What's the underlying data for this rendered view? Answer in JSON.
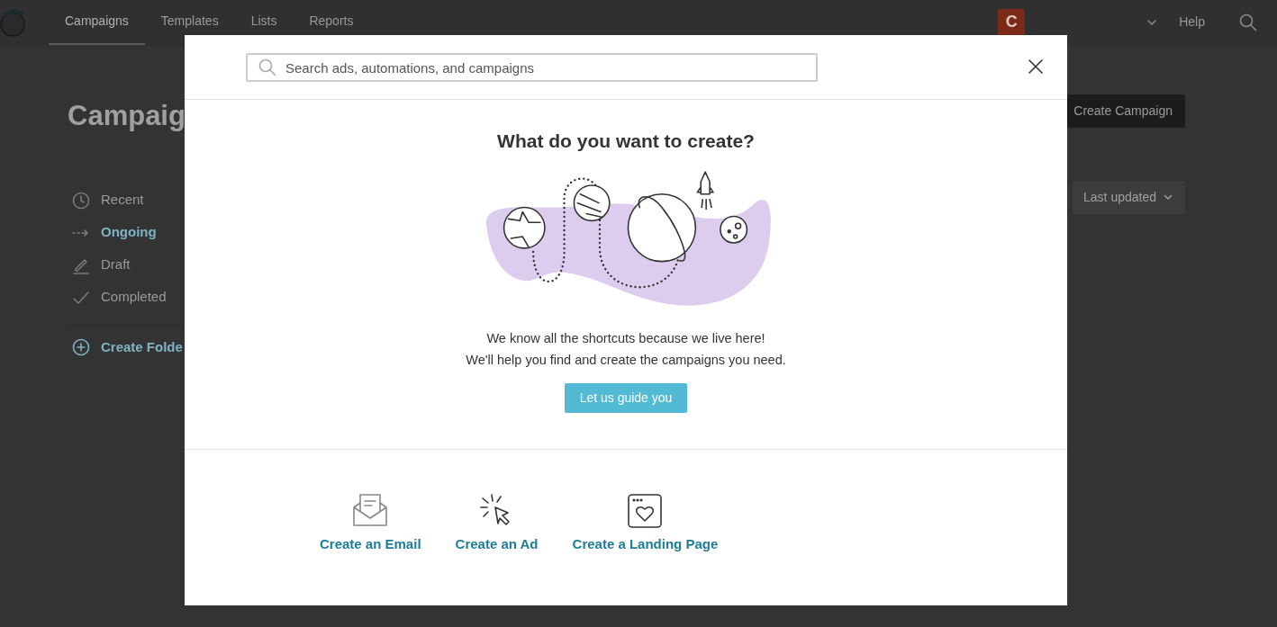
{
  "nav": {
    "items": [
      {
        "label": "Campaigns",
        "selected": true
      },
      {
        "label": "Templates",
        "selected": false
      },
      {
        "label": "Lists",
        "selected": false
      },
      {
        "label": "Reports",
        "selected": false
      }
    ],
    "account": {
      "initial": "C"
    },
    "help": "Help"
  },
  "page": {
    "title": "Campaig",
    "filters": [
      {
        "label": "Recent",
        "kind": "clock",
        "selected": false
      },
      {
        "label": "Ongoing",
        "kind": "arrow",
        "selected": true
      },
      {
        "label": "Draft",
        "kind": "pencil",
        "selected": false
      },
      {
        "label": "Completed",
        "kind": "check",
        "selected": false
      }
    ],
    "create_folder": "Create Folde",
    "create_button": "Create Campaign",
    "sort": "Last updated"
  },
  "modal": {
    "search": {
      "placeholder": "Search ads, automations, and campaigns"
    },
    "heading": "What do you want to create?",
    "message": [
      "We know all the shortcuts because we live here!",
      "We'll help you find and create the campaigns you need."
    ],
    "guide_button": "Let us guide you",
    "options": [
      {
        "label": "Create an Email",
        "kind": "email"
      },
      {
        "label": "Create an Ad",
        "kind": "ad"
      },
      {
        "label": "Create a Landing Page",
        "kind": "landing"
      }
    ]
  }
}
